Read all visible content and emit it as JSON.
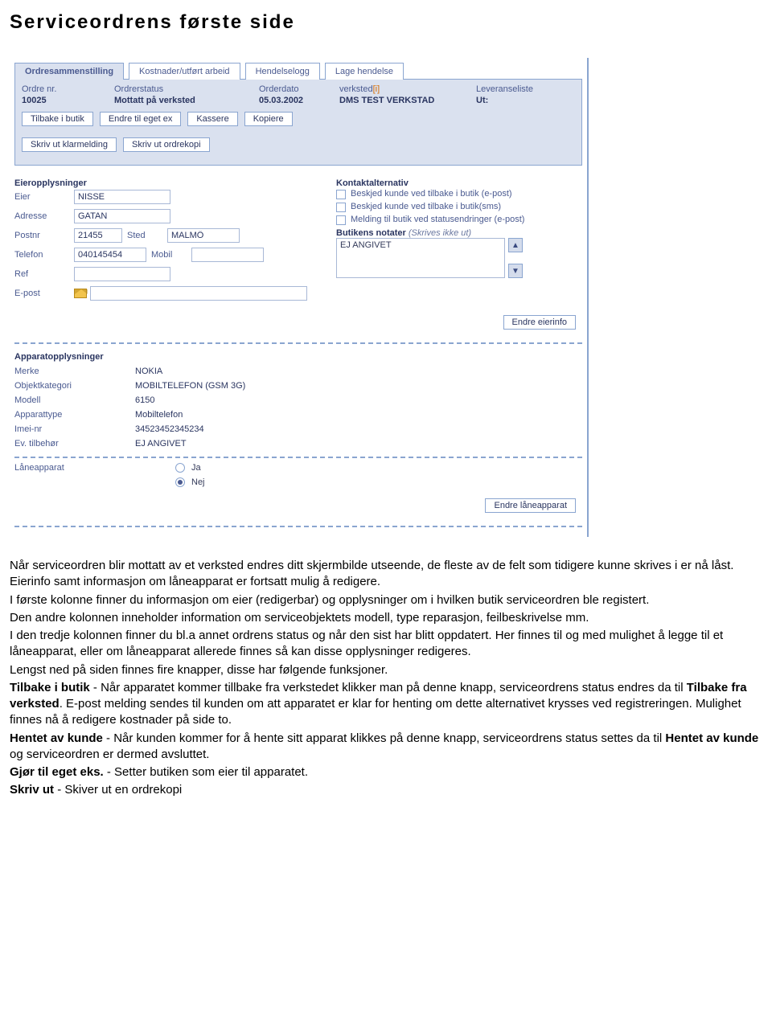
{
  "page_title": "Serviceordrens første side",
  "tabs": [
    "Ordresammenstilling",
    "Kostnader/utført arbeid",
    "Hendelselogg",
    "Lage hendelse"
  ],
  "header": {
    "labels": {
      "ordre_nr": "Ordre nr.",
      "ordrerstatus": "Ordrerstatus",
      "orderdato": "Orderdato",
      "verksted": "verksted",
      "verksted_suffix": "[i]",
      "leveranseliste": "Leveranseliste"
    },
    "values": {
      "ordre_nr": "10025",
      "ordrerstatus": "Mottatt på verksted",
      "orderdato": "05.03.2002",
      "verksted": "DMS TEST VERKSTAD",
      "leveranseliste": "Ut:"
    }
  },
  "buttons": {
    "row1": [
      "Tilbake i butik",
      "Endre til eget ex",
      "Kassere",
      "Kopiere"
    ],
    "row2": [
      "Skriv ut klarmelding",
      "Skriv ut ordrekopi"
    ],
    "endre_eier": "Endre eierinfo",
    "endre_lane": "Endre låneapparat"
  },
  "owner": {
    "section_title": "Eieropplysninger",
    "labels": {
      "eier": "Eier",
      "adresse": "Adresse",
      "postnr": "Postnr",
      "sted": "Sted",
      "telefon": "Telefon",
      "mobil": "Mobil",
      "ref": "Ref",
      "epost": "E-post"
    },
    "values": {
      "eier": "NISSE",
      "adresse": "GATAN",
      "postnr": "21455",
      "sted": "MALMÖ",
      "telefon": "040145454",
      "mobil": "",
      "ref": "",
      "epost": ""
    }
  },
  "contact": {
    "section_title": "Kontaktalternativ",
    "opts": [
      "Beskjed kunde ved tilbake i butik (e-post)",
      "Beskjed kunde ved tilbake i butik(sms)",
      "Melding til butik ved statusendringer (e-post)"
    ],
    "notes_label": "Butikens notater",
    "notes_hint": "(Skrives ikke ut)",
    "notes_value": "EJ ANGIVET"
  },
  "device": {
    "section_title": "Apparatopplysninger",
    "rows": [
      {
        "label": "Merke",
        "value": "NOKIA"
      },
      {
        "label": "Objektkategori",
        "value": "MOBILTELEFON (GSM 3G)"
      },
      {
        "label": "Modell",
        "value": "6150"
      },
      {
        "label": "Apparattype",
        "value": "Mobiltelefon"
      },
      {
        "label": "Imei-nr",
        "value": "34523452345234"
      },
      {
        "label": "Ev. tilbehør",
        "value": "EJ ANGIVET"
      }
    ],
    "loan_label": "Låneapparat",
    "loan_opts": {
      "yes": "Ja",
      "no": "Nej"
    },
    "loan_selected": "no"
  },
  "doc": {
    "p1": "Når serviceordren blir mottatt av et verksted endres ditt skjermbilde utseende, de fleste av de felt som tidigere kunne skrives i er nå låst. Eierinfo samt informasjon om låneapparat er fortsatt mulig å redigere.",
    "p2": "I første kolonne finner du informasjon om eier (redigerbar) og opplysninger om i hvilken butik serviceordren ble registert.",
    "p3": "Den andre kolonnen inneholder information om serviceobjektets modell, type reparasjon, feilbeskrivelse mm.",
    "p4": "I den tredje kolonnen finner du bl.a annet ordrens status og når den sist har blitt oppdatert. Her finnes til og med mulighet å legge til et låneapparat, eller om låneapparat allerede finnes så kan disse opplysninger redigeres.",
    "p5": "Lengst ned på siden finnes fire knapper, disse har følgende funksjoner.",
    "p6a": "Tilbake i butik",
    "p6b": " - Når apparatet kommer tillbake fra verkstedet klikker man på denne knapp, serviceordrens status endres da til ",
    "p6c": "Tilbake fra verksted",
    "p6d": ". E-post melding sendes til kunden om att apparatet er klar for henting om dette alternativet krysses ved registreringen. Mulighet finnes nå å redigere kostnader på side to.",
    "p7a": "Hentet av kunde",
    "p7b": " - Når kunden kommer for å hente sitt apparat klikkes på denne knapp, serviceordrens status settes da til ",
    "p7c": "Hentet av kunde",
    "p7d": " og serviceordren er dermed avsluttet.",
    "p8a": "Gjør til eget eks.",
    "p8b": " - Setter butiken som eier til apparatet.",
    "p9a": "Skriv ut",
    "p9b": " - Skiver ut en ordrekopi"
  }
}
